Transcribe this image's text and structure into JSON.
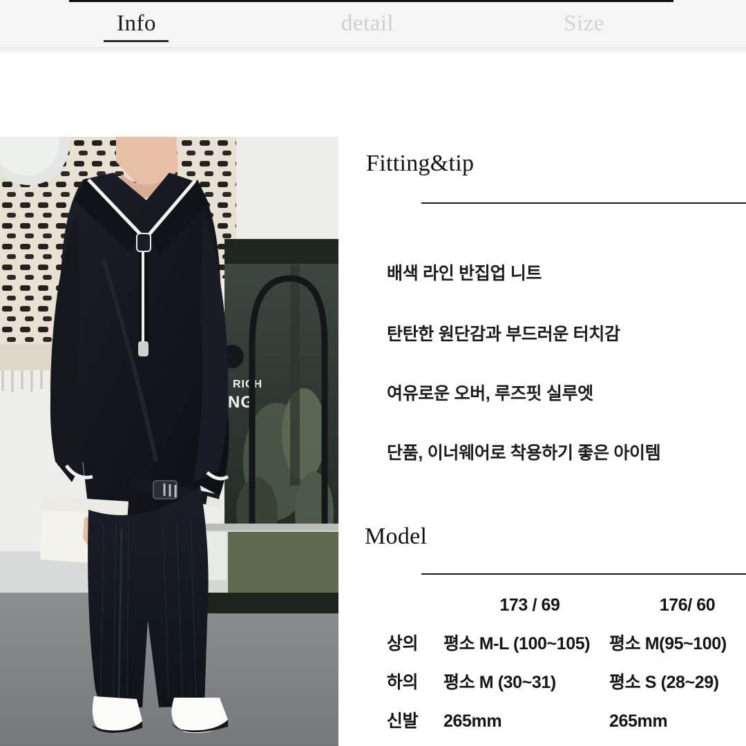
{
  "tabs": [
    {
      "label": "Info",
      "active": true
    },
    {
      "label": "detail",
      "active": false
    },
    {
      "label": "Size",
      "active": false
    }
  ],
  "photo": {
    "alt": "model-wearing-black-half-zip-knit-and-wide-navy-trousers"
  },
  "fitting": {
    "heading": "Fitting&tip",
    "lines": [
      "배색 라인 반집업 니트",
      "탄탄한 원단감과 부드러운 터치감",
      "여유로운 오버, 루즈핏 실루엣",
      "단품, 이너웨어로 착용하기 좋은 아이템"
    ]
  },
  "model": {
    "heading": "Model",
    "header": {
      "label": "",
      "col1": "173 / 69",
      "col2": "176/ 60"
    },
    "rows": [
      {
        "label": "상의",
        "col1": "평소 M-L (100~105)",
        "col2": "평소 M(95~100)"
      },
      {
        "label": "하의",
        "col1": "평소 M (30~31)",
        "col2": "평소 S (28~29)"
      },
      {
        "label": "신발",
        "col1": "265mm",
        "col2": "265mm"
      }
    ]
  },
  "colors": {
    "tabbar_bg": "#f5f5f5",
    "tab_active": "#1a1a1a",
    "tab_inactive": "#cfcfcf",
    "rule": "#1c1c1c",
    "text": "#151515",
    "page_bg": "#ffffff"
  }
}
